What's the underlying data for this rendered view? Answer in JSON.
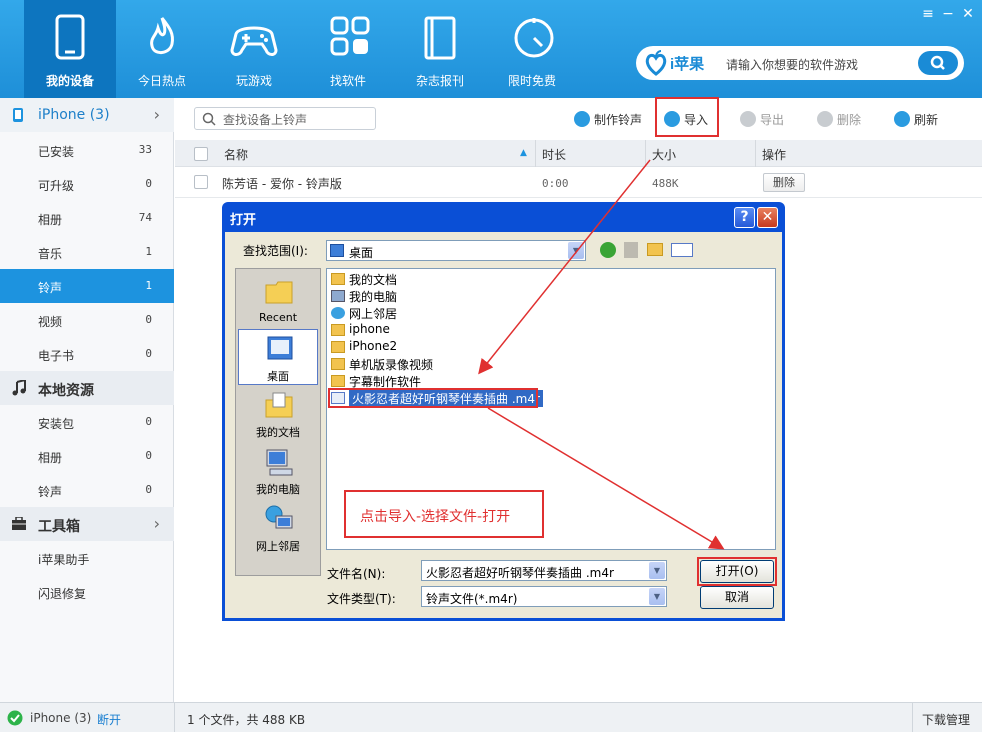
{
  "window": {
    "min": "−",
    "close": "✕",
    "menu": "≡"
  },
  "nav": [
    {
      "label": "我的设备",
      "icon": "phone-icon"
    },
    {
      "label": "今日热点",
      "icon": "flame-icon"
    },
    {
      "label": "玩游戏",
      "icon": "gamepad-icon"
    },
    {
      "label": "找软件",
      "icon": "apps-grid-icon"
    },
    {
      "label": "杂志报刊",
      "icon": "book-icon"
    },
    {
      "label": "限时免费",
      "icon": "timer-icon"
    }
  ],
  "brand": {
    "name": "i苹果",
    "search_placeholder": "请输入你想要的软件游戏"
  },
  "sidebar": {
    "device": {
      "label": "iPhone (3)"
    },
    "device_items": [
      {
        "label": "已安装",
        "count": "33"
      },
      {
        "label": "可升级",
        "count": "0"
      },
      {
        "label": "相册",
        "count": "74"
      },
      {
        "label": "音乐",
        "count": "1"
      },
      {
        "label": "铃声",
        "count": "1"
      },
      {
        "label": "视频",
        "count": "0"
      },
      {
        "label": "电子书",
        "count": "0"
      }
    ],
    "local": {
      "label": "本地资源"
    },
    "local_items": [
      {
        "label": "安装包",
        "count": "0"
      },
      {
        "label": "相册",
        "count": "0"
      },
      {
        "label": "铃声",
        "count": "0"
      }
    ],
    "tools": {
      "label": "工具箱"
    },
    "tool_items": [
      {
        "label": "i苹果助手"
      },
      {
        "label": "闪退修复"
      }
    ]
  },
  "toolbar": {
    "search_placeholder": "查找设备上铃声",
    "make": "制作铃声",
    "import": "导入",
    "export": "导出",
    "delete": "删除",
    "refresh": "刷新"
  },
  "table": {
    "headers": {
      "name": "名称",
      "duration": "时长",
      "size": "大小",
      "action": "操作"
    },
    "rows": [
      {
        "name": "陈芳语 - 爱你 - 铃声版",
        "duration": "0:00",
        "size": "488K",
        "action": "删除"
      }
    ]
  },
  "statusbar": {
    "device": "iPhone (3)",
    "disconnect": "断开",
    "summary": "1 个文件，共 488 KB",
    "downloads": "下载管理"
  },
  "dialog": {
    "title": "打开",
    "help": "?",
    "close": "✕",
    "look_in_label": "查找范围(I):",
    "look_in_value": "桌面",
    "places": [
      {
        "label": "Recent"
      },
      {
        "label": "桌面"
      },
      {
        "label": "我的文档"
      },
      {
        "label": "我的电脑"
      },
      {
        "label": "网上邻居"
      }
    ],
    "files": [
      {
        "name": "我的文档",
        "icon": "folder-docs-icon"
      },
      {
        "name": "我的电脑",
        "icon": "computer-icon"
      },
      {
        "name": "网上邻居",
        "icon": "network-icon"
      },
      {
        "name": "iphone",
        "icon": "folder-icon"
      },
      {
        "name": "iPhone2",
        "icon": "folder-icon"
      },
      {
        "name": "单机版录像视频",
        "icon": "folder-icon"
      },
      {
        "name": "字幕制作软件",
        "icon": "folder-icon"
      },
      {
        "name": "火影忍者超好听钢琴伴奏插曲 .m4r",
        "icon": "audio-file-icon"
      }
    ],
    "filename_label": "文件名(N):",
    "filename_value": "火影忍者超好听钢琴伴奏插曲 .m4r",
    "filetype_label": "文件类型(T):",
    "filetype_value": "铃声文件(*.m4r)",
    "open": "打开(O)",
    "cancel": "取消"
  },
  "annotation": {
    "text": "点击导入-选择文件-打开",
    "color": "#e03030"
  },
  "colors": {
    "topbar": "#1e8fd8",
    "nav_active": "#0d75bf",
    "selected": "#1d93df",
    "xp_title": "#0a4fd6",
    "annotation": "#e03030"
  }
}
